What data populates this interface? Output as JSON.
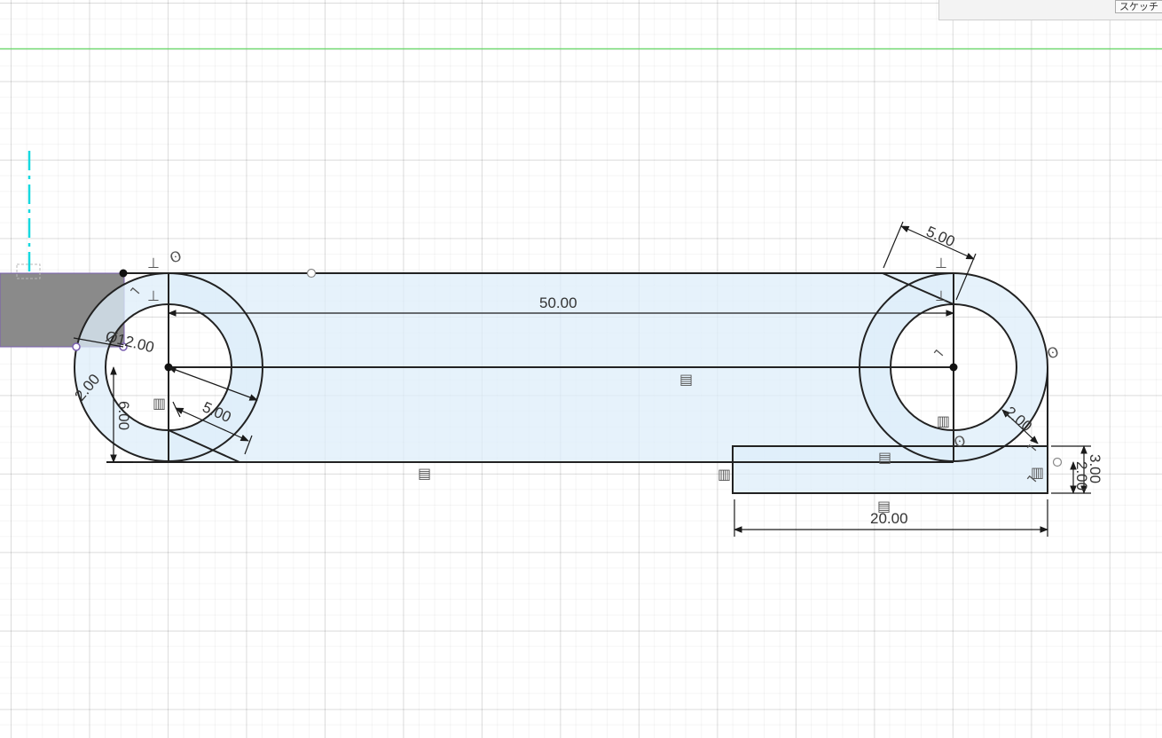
{
  "app": {
    "panel_button_label": "スケッチ"
  },
  "dimensions": {
    "overall_length": "50.00",
    "diameter": "Ø12.00",
    "left_offset_2": "2.00",
    "left_height_6": "6.00",
    "left_slot_5": "5.00",
    "right_slot_5": "5.00",
    "right_offset_2": "2.00",
    "bottom_width": "20.00",
    "bottom_height_3": "3.00",
    "bottom_height_2": "2.00"
  },
  "colors": {
    "sketch_fill": "#ddeefa",
    "profile_grey": "#8a8a8a",
    "green_axis": "#5fd35f",
    "cyan_axis": "#16d9e0",
    "line": "#222222"
  },
  "icons": [
    "perpendicular-constraint-icon",
    "coincident-constraint-icon",
    "horizontal-constraint-icon",
    "vertical-constraint-icon",
    "tangent-constraint-icon"
  ]
}
